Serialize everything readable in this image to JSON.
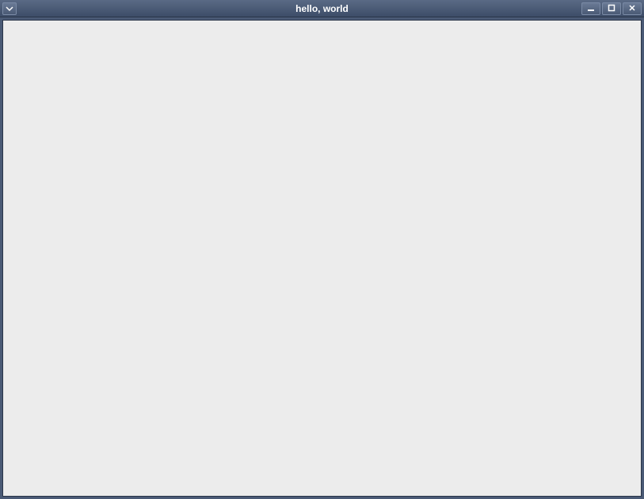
{
  "window": {
    "title": "hello, world"
  }
}
